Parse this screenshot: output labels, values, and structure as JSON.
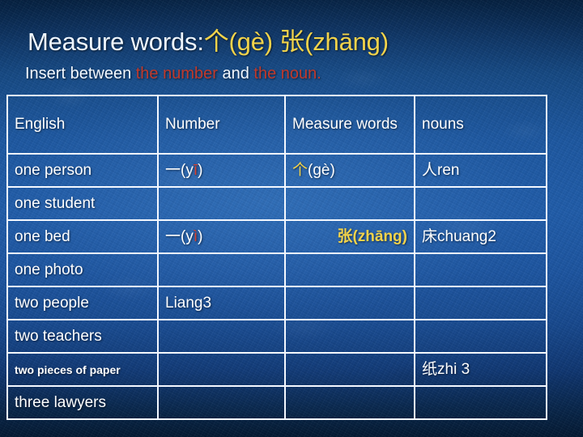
{
  "slide": {
    "title": {
      "prefix": "Measure words:",
      "term1_cjk": "个",
      "term1_pinyin": "(gè)",
      "term2_cjk": "张",
      "term2_pinyin": "(zhāng)"
    },
    "subtitle": {
      "part1": "Insert between ",
      "highlight1": "the number",
      "part2": " and ",
      "highlight2": "the noun",
      "part3": "."
    },
    "colors": {
      "background_blue": "#1f5dab",
      "background_dark": "#041930",
      "title_white": "#eef6ff",
      "accent_yellow": "#f2d34b",
      "accent_red": "#c0392b",
      "grid_line": "#f4f8ff"
    }
  },
  "table": {
    "headers": [
      "English",
      "Number",
      "Measure words",
      "nouns"
    ],
    "rows": [
      {
        "english": "one person",
        "number_cjk": "一",
        "number_pinyin_open": "(y",
        "number_tone": "ī",
        "number_pinyin_close": ")",
        "measure_cjk": "个",
        "measure_pinyin": "(gè)",
        "noun_cjk": "人",
        "noun_pinyin": "ren"
      },
      {
        "english": "one student",
        "number_cjk": "",
        "number_pinyin_open": "",
        "number_tone": "",
        "number_pinyin_close": "",
        "measure_cjk": "",
        "measure_pinyin": "",
        "noun_cjk": "",
        "noun_pinyin": ""
      },
      {
        "english": "one bed",
        "number_cjk": "一",
        "number_pinyin_open": "(y",
        "number_tone": "ì",
        "number_pinyin_close": ")",
        "measure_cjk": "张",
        "measure_pinyin": "(zhāng)",
        "noun_cjk": "床",
        "noun_pinyin": "chuang2"
      },
      {
        "english": "one photo",
        "number_cjk": "",
        "number_pinyin_open": "",
        "number_tone": "",
        "number_pinyin_close": "",
        "measure_cjk": "",
        "measure_pinyin": "",
        "noun_cjk": "",
        "noun_pinyin": ""
      },
      {
        "english": "two people",
        "number_cjk": "",
        "number_pinyin_open": "Liang3",
        "number_tone": "",
        "number_pinyin_close": "",
        "measure_cjk": "",
        "measure_pinyin": "",
        "noun_cjk": "",
        "noun_pinyin": ""
      },
      {
        "english": "two teachers",
        "number_cjk": "",
        "number_pinyin_open": "",
        "number_tone": "",
        "number_pinyin_close": "",
        "measure_cjk": "",
        "measure_pinyin": "",
        "noun_cjk": "",
        "noun_pinyin": ""
      },
      {
        "english": "two pieces of paper",
        "number_cjk": "",
        "number_pinyin_open": "",
        "number_tone": "",
        "number_pinyin_close": "",
        "measure_cjk": "",
        "measure_pinyin": "",
        "noun_cjk": "纸",
        "noun_pinyin": "zhi 3"
      },
      {
        "english": "three lawyers",
        "number_cjk": "",
        "number_pinyin_open": "",
        "number_tone": "",
        "number_pinyin_close": "",
        "measure_cjk": "",
        "measure_pinyin": "",
        "noun_cjk": "",
        "noun_pinyin": ""
      }
    ]
  }
}
